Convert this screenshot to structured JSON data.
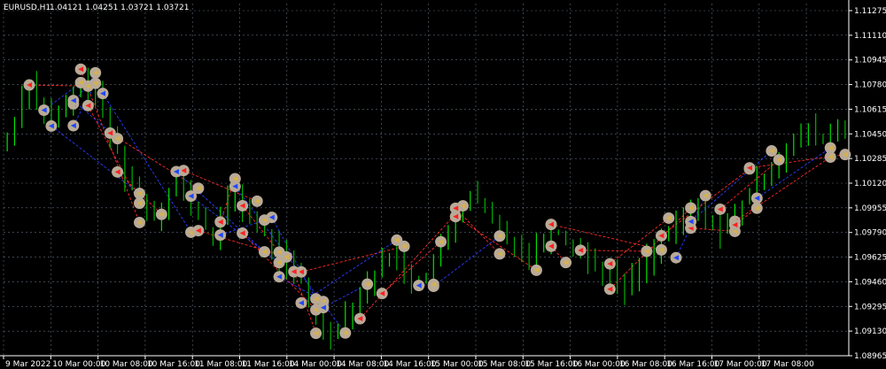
{
  "header": {
    "symbol_timeframe": "EURUSD,H1",
    "ohlc": "1.04121 1.04251 1.03721 1.03721"
  },
  "colors": {
    "background": "#000000",
    "grid": "#5f6d7b",
    "bull_candle": "#00e000",
    "bear_candle": "#00b000",
    "buy_line": "#2b3cff",
    "sell_line": "#ff2a2a",
    "marker_fill": "#b9aa97",
    "marker_arrow_buy": "#1e46ff",
    "marker_arrow_sell": "#ff2020",
    "marker_arrow_close": "#d6b24a"
  },
  "chart_data": {
    "type": "candlestick",
    "y_ticks": [
      "1.11275",
      "1.11110",
      "1.10945",
      "1.10780",
      "1.10615",
      "1.10450",
      "1.10285",
      "1.10120",
      "1.09955",
      "1.09790",
      "1.09625",
      "1.09460",
      "1.09295",
      "1.09130",
      "1.08965"
    ],
    "x_ticks": [
      "9 Mar 2022",
      "10 Mar 00:00",
      "10 Mar 08:00",
      "10 Mar 16:00",
      "11 Mar 08:00",
      "11 Mar 16:00",
      "14 Mar 00:00",
      "14 Mar 08:00",
      "14 Mar 16:00",
      "15 Mar 00:00",
      "15 Mar 08:00",
      "15 Mar 16:00",
      "16 Mar 00:00",
      "16 Mar 08:00",
      "16 Mar 16:00",
      "17 Mar 00:00",
      "17 Mar 08:00"
    ],
    "ylim": [
      1.08965,
      1.11275
    ],
    "close_series": [
      1.104,
      1.1055,
      1.1072,
      1.108,
      1.1066,
      1.1061,
      1.1052,
      1.1058,
      1.1063,
      1.107,
      1.1078,
      1.1075,
      1.1069,
      1.1058,
      1.1042,
      1.1035,
      1.1018,
      1.101,
      1.1003,
      1.0996,
      1.0991,
      1.0998,
      1.1006,
      1.1012,
      1.1005,
      1.0998,
      1.099,
      1.0982,
      1.0975,
      1.0988,
      1.0999,
      1.1006,
      1.0996,
      1.099,
      1.0982,
      1.0978,
      1.097,
      1.0963,
      1.0958,
      1.0952,
      1.0945,
      1.0933,
      1.0922,
      1.0916,
      1.0912,
      1.0918,
      1.0926,
      1.0931,
      1.0937,
      1.0946,
      1.0952,
      1.0958,
      1.0965,
      1.0962,
      1.0955,
      1.0948,
      1.0945,
      1.0951,
      1.0958,
      1.0968,
      1.0978,
      1.099,
      1.0997,
      1.1004,
      1.1,
      1.0992,
      1.0986,
      1.0981,
      1.0976,
      1.0972,
      1.0968,
      1.0965,
      1.097,
      1.0975,
      1.098,
      1.0978,
      1.0974,
      1.097,
      1.0966,
      1.0962,
      1.0958,
      1.0954,
      1.095,
      1.0946,
      1.0942,
      1.0948,
      1.0956,
      1.0962,
      1.0968,
      1.0974,
      1.0978,
      1.0982,
      1.0988,
      1.0992,
      1.0996,
      1.099,
      1.0985,
      1.098,
      1.0984,
      1.099,
      1.0998,
      1.1005,
      1.1012,
      1.1018,
      1.1024,
      1.103,
      1.1035,
      1.1038,
      1.1042,
      1.1048,
      1.1044,
      1.104,
      1.1046,
      1.105,
      1.1042
    ]
  }
}
